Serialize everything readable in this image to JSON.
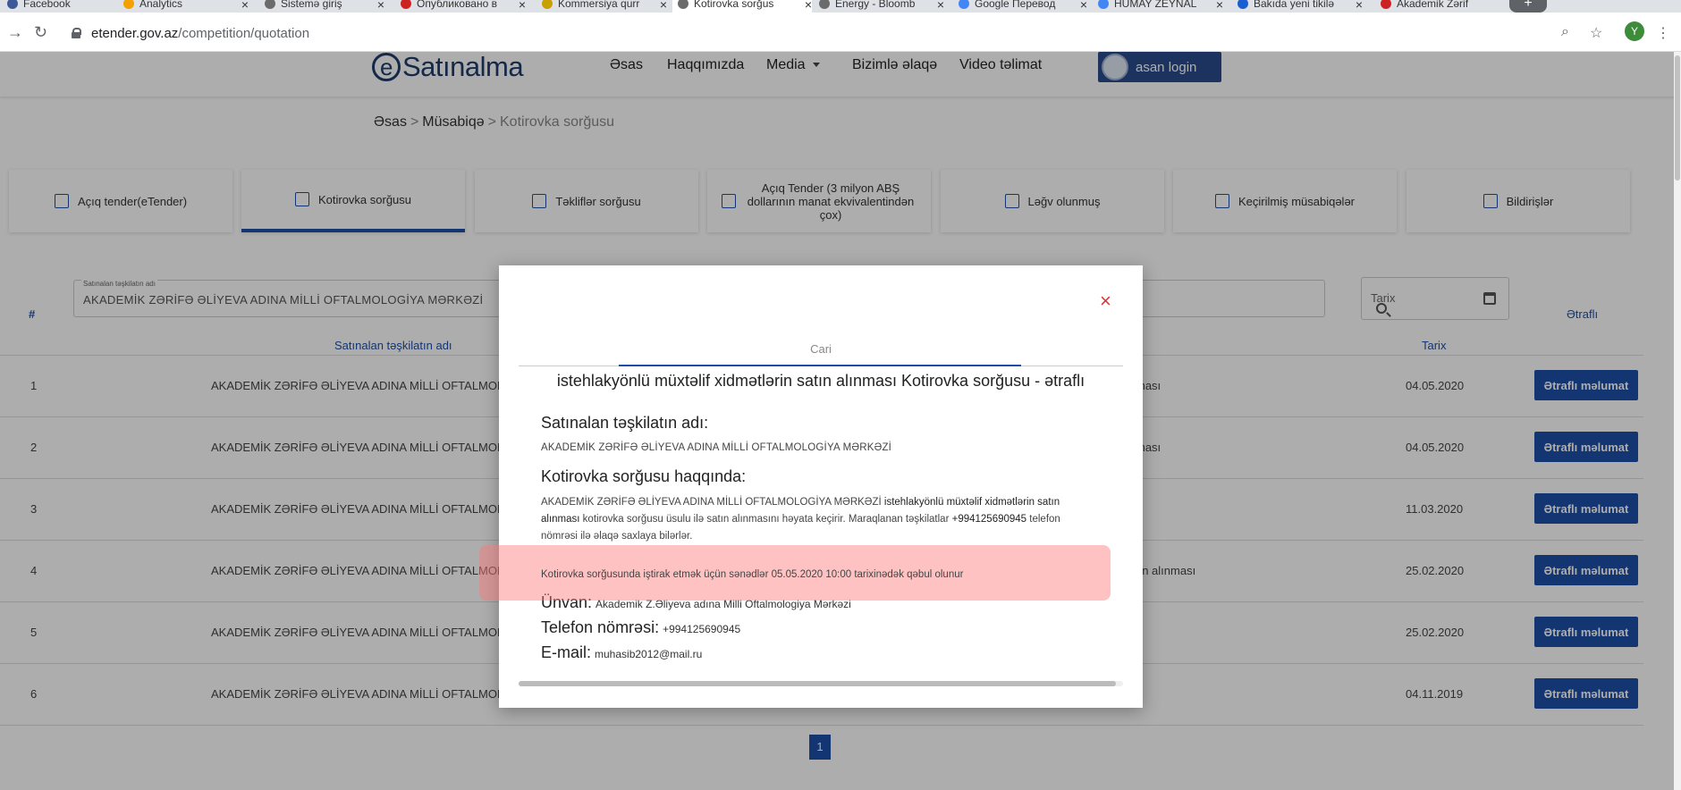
{
  "browser": {
    "tabs": [
      {
        "label": "Facebook",
        "favicon_color": "#3b5998"
      },
      {
        "label": "Analytics",
        "favicon_color": "#f4a100"
      },
      {
        "label": "Sistemə giriş",
        "favicon_color": "#6b6b6b"
      },
      {
        "label": "Опубликовано в",
        "favicon_color": "#cc2222"
      },
      {
        "label": "Kommersiya qurr",
        "favicon_color": "#c8a000"
      },
      {
        "label": "Kotirovka sorğus",
        "favicon_color": "#6b6b6b"
      },
      {
        "label": "Energy - Bloomb",
        "favicon_color": "#6b6b6b"
      },
      {
        "label": "Google Перевод",
        "favicon_color": "#4285f4"
      },
      {
        "label": "HUMAY ZEYNAL",
        "favicon_color": "#4285f4"
      },
      {
        "label": "Bakıda yeni tikilə",
        "favicon_color": "#1a5fd0"
      },
      {
        "label": "Akademik Zərif",
        "favicon_color": "#cc2222"
      }
    ],
    "url_host": "etender.gov.az",
    "url_path": "/competition/quotation",
    "profile_initial": "Y"
  },
  "header": {
    "logo_e": "e",
    "logo_text": "Satınalma",
    "nav": [
      "Əsas",
      "Haqqımızda",
      "Media",
      "Bizimlə əlaqə",
      "Video təlimat"
    ],
    "login_label": "asan login"
  },
  "breadcrumb": {
    "home": "Əsas",
    "sep": ">",
    "section": "Müsabiqə",
    "current": "Kotirovka sorğusu"
  },
  "categories": [
    "Açıq tender(eTender)",
    "Kotirovka sorğusu",
    "Təkliflər sorğusu",
    "Açıq Tender (3 milyon ABŞ dollarının manat ekvivalentindən çox)",
    "Ləğv olunmuş",
    "Keçirilmiş müsabiqələr",
    "Bildirişlər"
  ],
  "filters": {
    "hash": "#",
    "org_label": "Satınalan təşkilatın adı",
    "org_value": "AKADEMİK ZƏRİFƏ ƏLİYEVA ADINA MİLLİ OFTALMOLOGİYA MƏRKƏZİ",
    "date_placeholder": "Tarix",
    "details_header": "Ətraflı",
    "col_org": "Satınalan təşkilatın adı",
    "col_date": "Tarix"
  },
  "rows": [
    {
      "num": "1",
      "org": "AKADEMİK ZƏRİFƏ ƏLİYEVA ADINA MİLLİ OFTALMOLO",
      "desc": "ması",
      "date": "04.05.2020",
      "btn": "Ətraflı məlumat"
    },
    {
      "num": "2",
      "org": "AKADEMİK ZƏRİFƏ ƏLİYEVA ADINA MİLLİ OFTALMOLO",
      "desc": "ması",
      "date": "04.05.2020",
      "btn": "Ətraflı məlumat"
    },
    {
      "num": "3",
      "org": "AKADEMİK ZƏRİFƏ ƏLİYEVA ADINA MİLLİ OFTALMOLO",
      "desc": "",
      "date": "11.03.2020",
      "btn": "Ətraflı məlumat"
    },
    {
      "num": "4",
      "org": "AKADEMİK ZƏRİFƏ ƏLİYEVA ADINA MİLLİ OFTALMOLO",
      "desc": "rin alınması",
      "date": "25.02.2020",
      "btn": "Ətraflı məlumat"
    },
    {
      "num": "5",
      "org": "AKADEMİK ZƏRİFƏ ƏLİYEVA ADINA MİLLİ OFTALMOLO",
      "desc": "",
      "date": "25.02.2020",
      "btn": "Ətraflı məlumat"
    },
    {
      "num": "6",
      "org": "AKADEMİK ZƏRİFƏ ƏLİYEVA ADINA MİLLİ OFTALMOLO",
      "desc": "",
      "date": "04.11.2019",
      "btn": "Ətraflı məlumat"
    }
  ],
  "pagination": {
    "current": "1"
  },
  "modal": {
    "close": "×",
    "tab": "Cari",
    "title": "istehlakyönlü müxtəlif xidmətlərin satın alınması Kotirovka sorğusu - ətraflı",
    "org_heading": "Satınalan təşkilatın adı:",
    "org_name": "AKADEMİK ZƏRİFƏ ƏLİYEVA ADINA MİLLİ OFTALMOLOGİYA MƏRKƏZİ",
    "about_heading": "Kotirovka sorğusu haqqında:",
    "about_org": "AKADEMİK ZƏRİFƏ ƏLİYEVA ADINA MİLLİ OFTALMOLOGİYA MƏRKƏZİ",
    "about_subject": "istehlakyönlü müxtəlif xidmətlərin satın alınması",
    "about_text": "kotirovka sorğusu üsulu ilə satın alınmasını həyata keçirir. Maraqlanan təşkilatlar",
    "about_phone": "+994125690945",
    "about_contact": "telefon nömrəsi ilə əlaqə saxlaya bilərlər.",
    "deadline": "Kotirovka sorğusunda iştirak etmək üçün sənədlər 05.05.2020 10:00 tarixinədək qəbul olunur",
    "address_label": "Ünvan:",
    "address": "Akademik Z.Əliyeva adına Milli Oftalmologiya Mərkəzi",
    "phone_label": "Telefon nömrəsi:",
    "phone": "+994125690945",
    "email_label": "E-mail:",
    "email": "muhasib2012@mail.ru"
  },
  "colors": {
    "brand": "#1c4ea8",
    "logo": "#1f3b6b",
    "highlight": "#ff7878",
    "close": "#dd3333"
  }
}
